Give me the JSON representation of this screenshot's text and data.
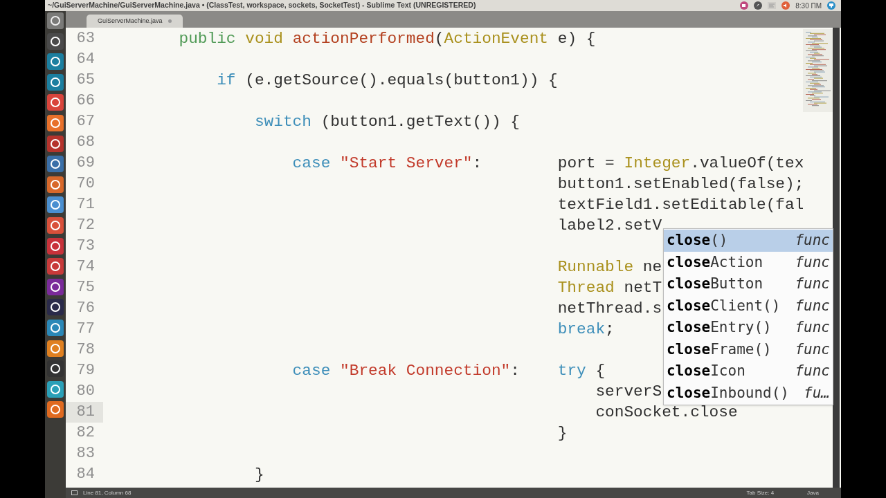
{
  "top_panel": {
    "title": "~/GuiServerMachine/GuiServerMachine.java • (ClassTest, workspace, sockets, SocketTest) - Sublime Text (UNREGISTERED)",
    "clock": "8:30 ПМ"
  },
  "launcher": {
    "items": [
      {
        "color": "#4a4a4a"
      },
      {
        "color": "#1b7fa0"
      },
      {
        "color": "#1b7fa0"
      },
      {
        "color": "#d9443b"
      },
      {
        "color": "#e8702a"
      },
      {
        "color": "#b5332c"
      },
      {
        "color": "#3a6fa8"
      },
      {
        "color": "#d8682a"
      },
      {
        "color": "#4a8fd0"
      },
      {
        "color": "#d9503a"
      },
      {
        "color": "#c8323a"
      },
      {
        "color": "#c83a3a"
      },
      {
        "color": "#7a2a9a"
      },
      {
        "color": "#2a2a4a"
      },
      {
        "color": "#2a88b8"
      },
      {
        "color": "#e08020"
      },
      {
        "color": "#333333"
      },
      {
        "color": "#2aa0b8"
      },
      {
        "color": "#e06a20"
      }
    ]
  },
  "tabs": [
    {
      "label": "GuiServerMachine.java",
      "selected": true,
      "modified": true
    }
  ],
  "editor": {
    "lines": [
      {
        "kind": "line",
        "number": "63",
        "current": false,
        "tokens": [
          {
            "text": "public",
            "kind": "modifier"
          },
          {
            "text": " void",
            "kind": "type"
          },
          {
            "text": " actionPerformed",
            "kind": "function"
          },
          {
            "text": "(",
            "kind": "plain"
          },
          {
            "text": "ActionEvent",
            "kind": "type"
          },
          {
            "text": " e) {",
            "kind": "plain"
          }
        ],
        "children": [
          {
            "kind": "line",
            "number": "64",
            "current": false
          },
          {
            "kind": "line",
            "number": "65",
            "current": false,
            "tokens": [
              {
                "text": "if",
                "kind": "keyword"
              },
              {
                "text": " (e.getSource().equals(button1)) {",
                "kind": "plain"
              }
            ],
            "children": [
              {
                "kind": "line",
                "number": "66",
                "current": false
              },
              {
                "kind": "line",
                "number": "67",
                "current": false,
                "tokens": [
                  {
                    "text": "switch",
                    "kind": "keyword"
                  },
                  {
                    "text": " (button1.getText()) {",
                    "kind": "plain"
                  }
                ],
                "children": [
                  {
                    "kind": "line",
                    "number": "68",
                    "current": false
                  },
                  {
                    "kind": "case",
                    "label": [
                      {
                        "text": "case",
                        "kind": "keyword"
                      },
                      {
                        "text": " \"Start Server\"",
                        "kind": "string"
                      },
                      {
                        "text": ":",
                        "kind": "plain"
                      }
                    ],
                    "statements": [
                      {
                        "number": "69",
                        "current": false,
                        "tokens": [
                          {
                            "text": "port = ",
                            "kind": "plain"
                          },
                          {
                            "text": "Integer",
                            "kind": "type"
                          },
                          {
                            "text": ".valueOf(tex",
                            "kind": "plain"
                          }
                        ]
                      },
                      {
                        "number": "70",
                        "current": false,
                        "tokens": [
                          {
                            "text": "button1.setEnabled(false);",
                            "kind": "plain"
                          }
                        ]
                      },
                      {
                        "number": "71",
                        "current": false,
                        "tokens": [
                          {
                            "text": "textField1.setEditable(fal",
                            "kind": "plain"
                          }
                        ]
                      },
                      {
                        "number": "72",
                        "current": false,
                        "tokens": [
                          {
                            "text": "label2.setV",
                            "kind": "plain"
                          }
                        ]
                      },
                      {
                        "number": "73",
                        "current": false
                      },
                      {
                        "number": "74",
                        "current": false,
                        "tokens": [
                          {
                            "text": "Runnable",
                            "kind": "type"
                          },
                          {
                            "text": " ne",
                            "kind": "plain"
                          }
                        ]
                      },
                      {
                        "number": "75",
                        "current": false,
                        "tokens": [
                          {
                            "text": "Thread",
                            "kind": "type"
                          },
                          {
                            "text": " netT",
                            "kind": "plain"
                          }
                        ]
                      },
                      {
                        "number": "76",
                        "current": false,
                        "tokens": [
                          {
                            "text": "netThread.s",
                            "kind": "plain"
                          }
                        ]
                      },
                      {
                        "number": "77",
                        "current": false,
                        "tokens": [
                          {
                            "text": "break",
                            "kind": "keyword"
                          },
                          {
                            "text": ";",
                            "kind": "plain"
                          }
                        ]
                      },
                      {
                        "number": "78",
                        "current": false
                      }
                    ]
                  },
                  {
                    "kind": "case",
                    "label": [
                      {
                        "text": "case",
                        "kind": "keyword"
                      },
                      {
                        "text": " \"Break Connection\"",
                        "kind": "string"
                      },
                      {
                        "text": ":",
                        "kind": "plain"
                      }
                    ],
                    "statements": [
                      {
                        "number": "79",
                        "current": false,
                        "tokens": [
                          {
                            "text": "try",
                            "kind": "keyword"
                          },
                          {
                            "text": " {",
                            "kind": "plain"
                          }
                        ],
                        "children": [
                          {
                            "number": "80",
                            "current": false,
                            "tokens": [
                              {
                                "text": "serverS",
                                "kind": "plain"
                              }
                            ]
                          },
                          {
                            "number": "81",
                            "current": true,
                            "tokens": [
                              {
                                "text": "conSocket.close",
                                "kind": "plain"
                              }
                            ]
                          }
                        ]
                      },
                      {
                        "number": "82",
                        "current": false,
                        "tokens": [
                          {
                            "text": "}",
                            "kind": "plain"
                          }
                        ]
                      }
                    ]
                  },
                  {
                    "kind": "line",
                    "number": "83",
                    "current": false
                  }
                ]
              },
              {
                "kind": "line",
                "number": "84",
                "current": false,
                "tokens": [
                  {
                    "text": "}",
                    "kind": "plain"
                  }
                ]
              }
            ]
          }
        ]
      }
    ]
  },
  "completions": [
    {
      "match": "close",
      "rest": "()",
      "type": "func",
      "selected": true
    },
    {
      "match": "close",
      "rest": "Action",
      "type": "func",
      "selected": false
    },
    {
      "match": "close",
      "rest": "Button",
      "type": "func",
      "selected": false
    },
    {
      "match": "close",
      "rest": "Client()",
      "type": "func",
      "selected": false
    },
    {
      "match": "close",
      "rest": "Entry()",
      "type": "func",
      "selected": false
    },
    {
      "match": "close",
      "rest": "Frame()",
      "type": "func",
      "selected": false
    },
    {
      "match": "close",
      "rest": "Icon",
      "type": "func",
      "selected": false
    },
    {
      "match": "close",
      "rest": "Inbound()",
      "type": "fu…",
      "selected": false
    }
  ],
  "status_bar": {
    "position": "Line 81, Column 68",
    "tab_size": "Tab Size: 4",
    "syntax": "Java"
  }
}
